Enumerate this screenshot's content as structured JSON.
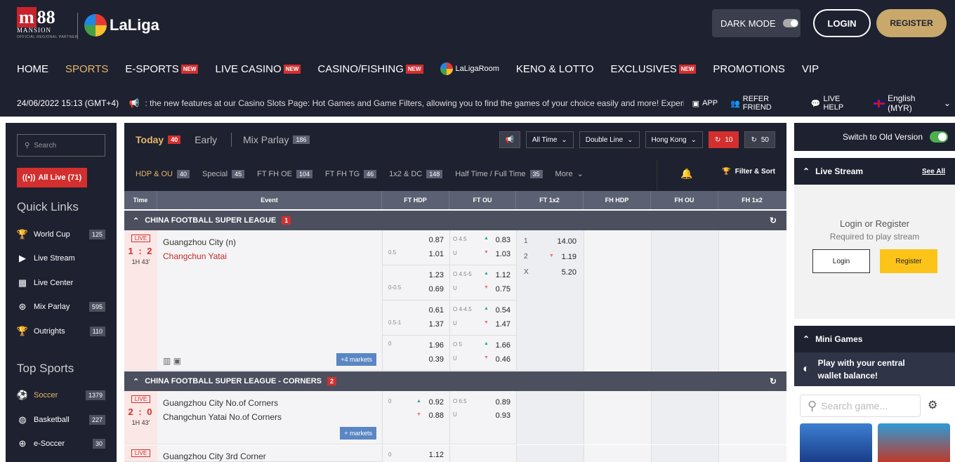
{
  "brand": {
    "m88": "88",
    "mansion": "MANSION",
    "partner": "OFFICIAL REGIONAL PARTNER",
    "laliga": "LaLiga"
  },
  "header": {
    "dark_mode": "DARK MODE",
    "login": "LOGIN",
    "register": "REGISTER"
  },
  "nav": [
    {
      "label": "HOME"
    },
    {
      "label": "SPORTS",
      "active": true
    },
    {
      "label": "E-SPORTS",
      "badge": "NEW"
    },
    {
      "label": "LIVE CASINO",
      "badge": "NEW"
    },
    {
      "label": "CASINO/FISHING",
      "badge": "NEW"
    },
    {
      "label": "LaLigaRoom"
    },
    {
      "label": "KENO & LOTTO"
    },
    {
      "label": "EXCLUSIVES",
      "badge": "NEW"
    },
    {
      "label": "PROMOTIONS"
    },
    {
      "label": "VIP"
    }
  ],
  "ticker": {
    "datetime": "24/06/2022 15:13 (GMT+4)",
    "message": ": the new features at our Casino Slots Page: Hot Games and Game Filters, allowing you to find the games of your choice easily and more! Experience th",
    "app": "APP",
    "refer": "REFER FRIEND",
    "help": "LIVE HELP",
    "lang": "English (MYR)"
  },
  "left": {
    "search": "Search",
    "all_live": "All Live (71)",
    "quick_links": "Quick Links",
    "top_sports": "Top Sports",
    "quick": [
      {
        "label": "World Cup",
        "count": "125"
      },
      {
        "label": "Live Stream",
        "count": ""
      },
      {
        "label": "Live Center",
        "count": ""
      },
      {
        "label": "Mix Parlay",
        "count": "595"
      },
      {
        "label": "Outrights",
        "count": "110"
      }
    ],
    "sports": [
      {
        "label": "Soccer",
        "count": "1379"
      },
      {
        "label": "Basketball",
        "count": "227"
      },
      {
        "label": "e-Soccer",
        "count": "30"
      }
    ]
  },
  "mid": {
    "tabs": [
      {
        "label": "Today",
        "count": "40"
      },
      {
        "label": "Early",
        "count": ""
      },
      {
        "label": "Mix Parlay",
        "count": "186"
      }
    ],
    "ctrl": {
      "time": "All Time",
      "line": "Double Line",
      "odds": "Hong Kong",
      "c1": "10",
      "c2": "50"
    },
    "sub": [
      {
        "label": "HDP & OU",
        "count": "40"
      },
      {
        "label": "Special",
        "count": "45"
      },
      {
        "label": "FT FH OE",
        "count": "104"
      },
      {
        "label": "FT FH TG",
        "count": "46"
      },
      {
        "label": "1x2 & DC",
        "count": "148"
      },
      {
        "label": "Half Time / Full Time",
        "count": "35"
      },
      {
        "label": "More",
        "count": ""
      }
    ],
    "filter": "Filter & Sort",
    "cols": [
      "Time",
      "Event",
      "FT HDP",
      "FT OU",
      "FT 1x2",
      "FH HDP",
      "FH OU",
      "FH 1x2"
    ],
    "league1": {
      "name": "CHINA FOOTBALL SUPER LEAGUE",
      "count": "1"
    },
    "match1": {
      "live": "LIVE",
      "score": "1 : 2",
      "minute": "1H 43'",
      "home": "Guangzhou City (n)",
      "away": "Changchun Yatai",
      "more": "+4 markets",
      "hdp": [
        {
          "line": "0.5",
          "h": "0.87",
          "a": "1.01"
        },
        {
          "line": "0-0.5",
          "h": "1.23",
          "a": "0.69"
        },
        {
          "line": "0.5-1",
          "h": "0.61",
          "a": "1.37"
        },
        {
          "line": "0",
          "h": "1.96",
          "a": "0.39"
        }
      ],
      "ou": [
        {
          "o": "O 4.5",
          "u": "U",
          "ov": "0.83",
          "uv": "1.03"
        },
        {
          "o": "O 4.5-5",
          "u": "U",
          "ov": "1.12",
          "uv": "0.75"
        },
        {
          "o": "O 4-4.5",
          "u": "U",
          "ov": "0.54",
          "uv": "1.47"
        },
        {
          "o": "O 5",
          "u": "U",
          "ov": "1.66",
          "uv": "0.46"
        }
      ],
      "x12": [
        {
          "k": "1",
          "v": "14.00"
        },
        {
          "k": "2",
          "v": "1.19"
        },
        {
          "k": "X",
          "v": "5.20"
        }
      ]
    },
    "league2": {
      "name": "CHINA FOOTBALL SUPER LEAGUE - CORNERS",
      "count": "2"
    },
    "match2": {
      "live": "LIVE",
      "score": "2 : 0",
      "minute": "1H 43'",
      "home": "Guangzhou City No.of Corners",
      "away": "Changchun Yatai No.of Corners",
      "more": "+ markets",
      "hdp": {
        "line": "0",
        "h": "0.92",
        "a": "0.88"
      },
      "ou": {
        "o": "O 6.5",
        "u": "U",
        "ov": "0.89",
        "uv": "0.93"
      }
    },
    "match3": {
      "live": "LIVE",
      "home": "Guangzhou City 3rd Corner",
      "hdp": {
        "line": "0",
        "h": "1.12"
      }
    }
  },
  "right": {
    "old": "Switch to Old Version",
    "live_stream": "Live Stream",
    "see_all": "See All",
    "login_reg": "Login or Register",
    "req": "Required to play stream",
    "login": "Login",
    "register": "Register",
    "mini": "Mini Games",
    "wallet1": "Play with your central",
    "wallet2": "wallet balance!",
    "search_game": "Search game..."
  }
}
